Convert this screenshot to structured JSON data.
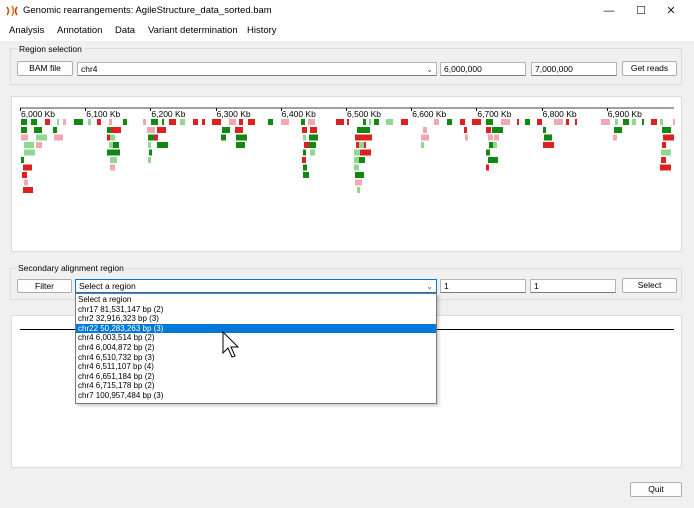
{
  "window": {
    "title": "Genomic rearrangements: AgileStructure_data_sorted.bam",
    "minimize_glyph": "—",
    "maximize_glyph": "☐",
    "close_glyph": "✕"
  },
  "menu": [
    "Analysis",
    "Annotation",
    "Data",
    "Variant determination",
    "History"
  ],
  "region_selection": {
    "label": "Region selection",
    "bam_button": "BAM file",
    "chromosome": "chr4",
    "start": "6,000,000",
    "end": "7,000,000",
    "get_reads_button": "Get reads"
  },
  "ruler": {
    "ticks": [
      "6,000 Kb",
      "6,100 Kb",
      "6,200 Kb",
      "6,300 Kb",
      "6,400 Kb",
      "6,500 Kb",
      "6,600 Kb",
      "6,700 Kb",
      "6,800 Kb",
      "6,900 Kb"
    ]
  },
  "secondary_region": {
    "label": "Secondary alignment region",
    "filter_button": "Filter",
    "region_combo": "Select a region",
    "start": "1",
    "end": "1",
    "select_button": "Select",
    "options": [
      "Select a region",
      "chr17 81,531,147 bp (2)",
      "chr2 32,916,323 bp (3)",
      "chr22 50,283,263 bp (3)",
      "chr4 6,003,514 bp (2)",
      "chr4 6,004,872 bp (2)",
      "chr4 6,510,732 bp (3)",
      "chr4 6,511,107 bp (4)",
      "chr4 6,651,184 bp (2)",
      "chr4 6,715,178 bp (2)",
      "chr7 100,957,484 bp (3)"
    ],
    "highlighted_option": "chr22 50,283,263 bp (3)"
  },
  "quit_button": "Quit",
  "colors": {
    "dark_green": "#118811",
    "light_green": "#8fd88f",
    "red": "#dd2020",
    "pink": "#f0a8b4",
    "highlight": "#0078d7"
  }
}
